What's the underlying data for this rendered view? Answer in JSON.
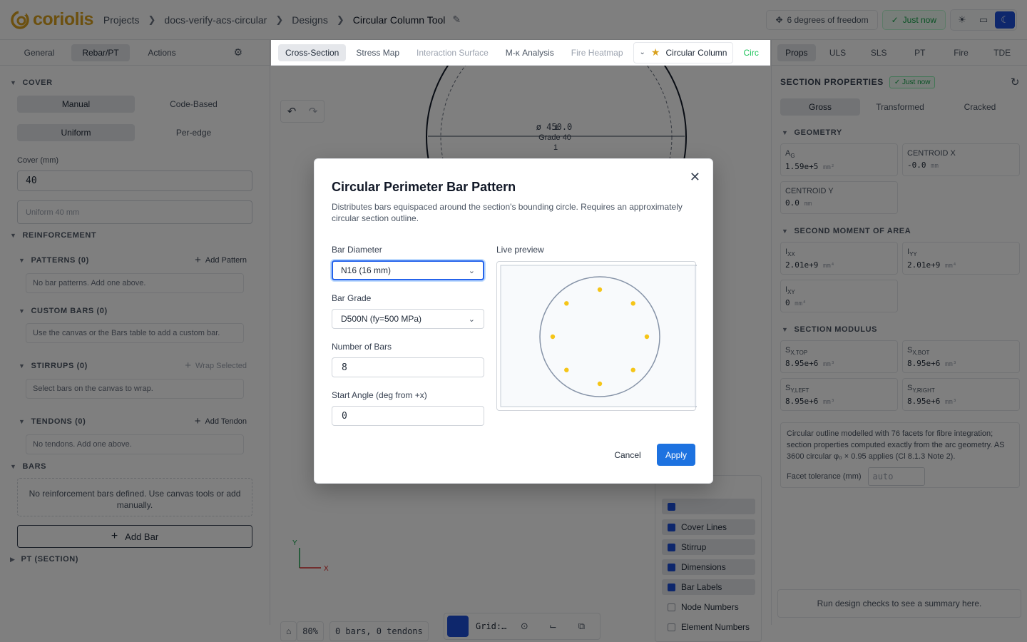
{
  "app": {
    "logo_text": "coriolis"
  },
  "breadcrumb": [
    "Projects",
    "docs-verify-acs-circular",
    "Designs",
    "Circular Column Tool"
  ],
  "topbar": {
    "dof_label": "6 degrees of freedom",
    "saved_label": "Just now"
  },
  "left": {
    "tabs": [
      "General",
      "Rebar/PT",
      "Actions"
    ],
    "cover": {
      "title": "COVER",
      "mode_options": [
        "Manual",
        "Code-Based"
      ],
      "distribution_options": [
        "Uniform",
        "Per-edge"
      ],
      "cover_label": "Cover (mm)",
      "cover_value": "40",
      "summary_placeholder": "Uniform 40 mm"
    },
    "reinforcement": {
      "title": "REINFORCEMENT",
      "patterns": {
        "title": "PATTERNS (0)",
        "action": "Add Pattern",
        "empty": "No bar patterns. Add one above."
      },
      "custom_bars": {
        "title": "CUSTOM BARS (0)",
        "empty": "Use the canvas or the Bars table to add a custom bar."
      },
      "stirrups": {
        "title": "STIRRUPS (0)",
        "action": "Wrap Selected",
        "empty": "Select bars on the canvas to wrap."
      },
      "tendons": {
        "title": "TENDONS (0)",
        "action": "Add Tendon",
        "empty": "No tendons. Add one above."
      }
    },
    "bars": {
      "title": "BARS",
      "empty": "No reinforcement bars defined. Use canvas tools or add manually.",
      "add_button": "Add Bar"
    },
    "pt": {
      "title": "PT (SECTION)"
    }
  },
  "center": {
    "tabs": [
      "Cross-Section",
      "Stress Map",
      "Interaction Surface",
      "M-κ Analysis",
      "Fire Heatmap"
    ],
    "preset_label": "Circular Column",
    "truncated_tab": "Circ",
    "section": {
      "dim_label": "ø 450.0",
      "dim_overlap": "1",
      "grade_label": "Grade 40",
      "grade_index": "1"
    },
    "axes": {
      "x": "X",
      "y": "Y"
    },
    "layers": [
      "Cover Lines",
      "Stirrup",
      "Dimensions",
      "Bar Labels",
      "Node Numbers",
      "Element Numbers"
    ],
    "layers_on": [
      true,
      true,
      true,
      true,
      false,
      false
    ],
    "zoom": "80%",
    "status": "0 bars, 0 tendons",
    "grid_label": "Grid:…"
  },
  "right": {
    "tabs": [
      "Props",
      "ULS",
      "SLS",
      "PT",
      "Fire",
      "TDE"
    ],
    "title": "SECTION PROPERTIES",
    "badge": "Just now",
    "modes": [
      "Gross",
      "Transformed",
      "Cracked"
    ],
    "geometry": {
      "title": "GEOMETRY",
      "ag": {
        "label": "A",
        "sub": "G",
        "value": "1.59e+5",
        "unit": "mm²"
      },
      "cx": {
        "label": "CENTROID X",
        "value": "-0.0",
        "unit": "mm"
      },
      "cy": {
        "label": "CENTROID Y",
        "value": "0.0",
        "unit": "mm"
      }
    },
    "second_moment": {
      "title": "SECOND MOMENT OF AREA",
      "ixx": {
        "label": "I",
        "sub": "XX",
        "value": "2.01e+9",
        "unit": "mm⁴"
      },
      "iyy": {
        "label": "I",
        "sub": "YY",
        "value": "2.01e+9",
        "unit": "mm⁴"
      },
      "ixy": {
        "label": "I",
        "sub": "XY",
        "value": "0",
        "unit": "mm⁴"
      }
    },
    "section_modulus": {
      "title": "SECTION MODULUS",
      "sxtop": {
        "label": "S",
        "sub": "X,TOP",
        "value": "8.95e+6",
        "unit": "mm³"
      },
      "sxbot": {
        "label": "S",
        "sub": "X,BOT",
        "value": "8.95e+6",
        "unit": "mm³"
      },
      "syleft": {
        "label": "S",
        "sub": "Y,LEFT",
        "value": "8.95e+6",
        "unit": "mm³"
      },
      "syright": {
        "label": "S",
        "sub": "Y,RIGHT",
        "value": "8.95e+6",
        "unit": "mm³"
      }
    },
    "note": "Circular outline modelled with 76 facets for fibre integration; section properties computed exactly from the arc geometry. AS 3600 circular φ₀ × 0.95 applies (Cl 8.1.3 Note 2).",
    "tolerance_label": "Facet tolerance (mm)",
    "tolerance_placeholder": "auto",
    "summary": "Run design checks to see a summary here."
  },
  "modal": {
    "title": "Circular Perimeter Bar Pattern",
    "description": "Distributes bars equispaced around the section's bounding circle. Requires an approximately circular section outline.",
    "bar_diameter_label": "Bar Diameter",
    "bar_diameter_value": "N16 (16 mm)",
    "bar_grade_label": "Bar Grade",
    "bar_grade_value": "D500N (fy=500 MPa)",
    "num_bars_label": "Number of Bars",
    "num_bars_value": 8,
    "start_angle_label": "Start Angle (deg from +x)",
    "start_angle_value": 0,
    "preview_label": "Live preview",
    "cancel_label": "Cancel",
    "apply_label": "Apply",
    "colors": {
      "bar": "#f5c518",
      "outline": "#8794a8",
      "accent": "#1d72e0"
    }
  }
}
